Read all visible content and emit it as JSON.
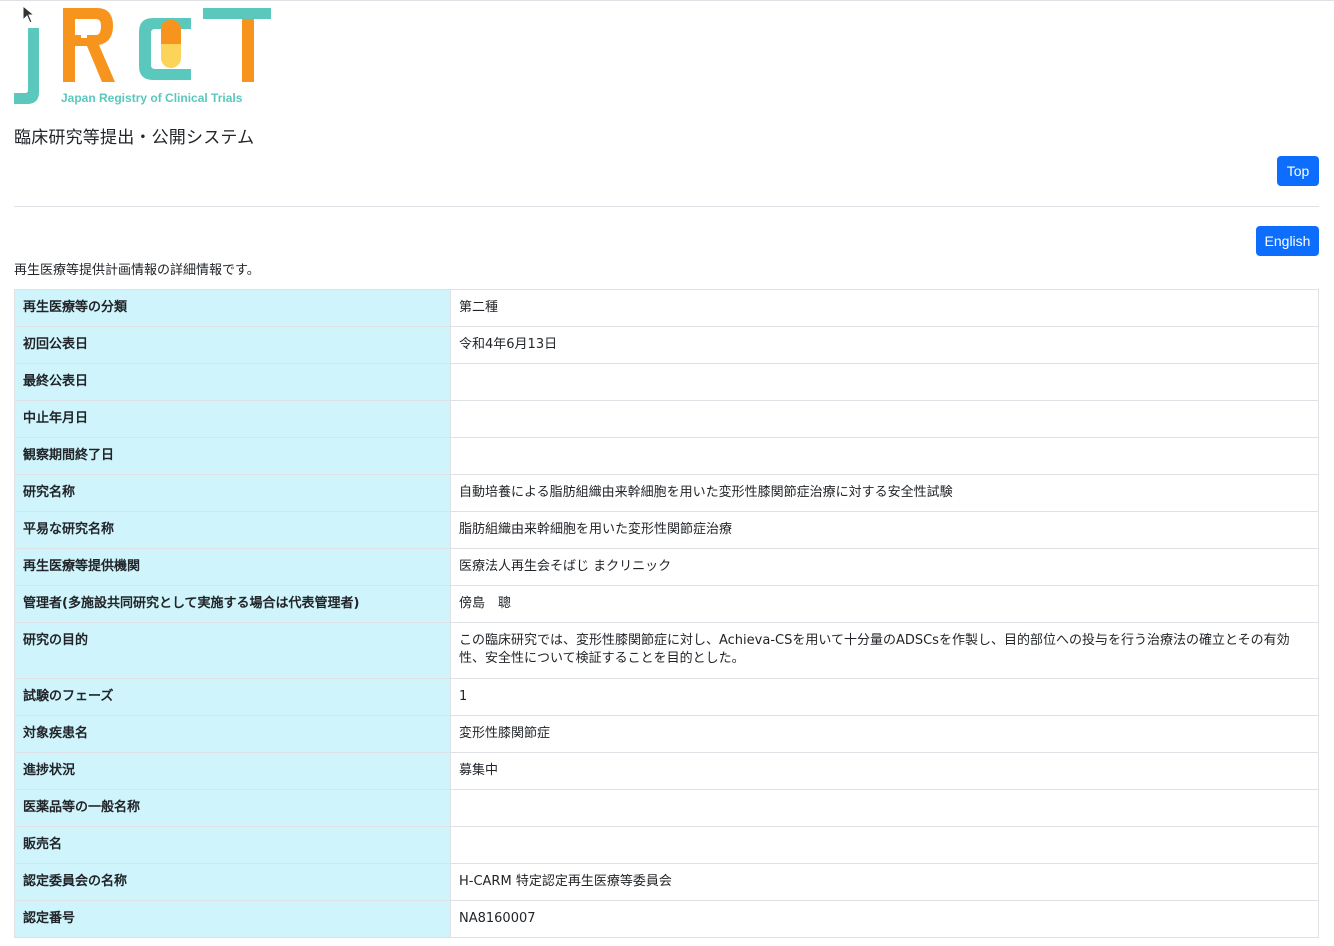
{
  "header": {
    "logo_text": "jRCT",
    "logo_subtitle": "Japan Registry of Clinical Trials",
    "system_title": "臨床研究等提出・公開システム",
    "top_button": "Top"
  },
  "language_button": "English",
  "intro_text": "再生医療等提供計画情報の詳細情報です。",
  "rows": [
    {
      "label": "再生医療等の分類",
      "value": "第二種"
    },
    {
      "label": "初回公表日",
      "value": "令和4年6月13日"
    },
    {
      "label": "最終公表日",
      "value": ""
    },
    {
      "label": "中止年月日",
      "value": ""
    },
    {
      "label": "観察期間終了日",
      "value": ""
    },
    {
      "label": "研究名称",
      "value": "自動培養による脂肪組織由来幹細胞を用いた変形性膝関節症治療に対する安全性試験"
    },
    {
      "label": "平易な研究名称",
      "value": "脂肪組織由来幹細胞を用いた変形性関節症治療"
    },
    {
      "label": "再生医療等提供機関",
      "value": "医療法人再生会そばじ まクリニック"
    },
    {
      "label": "管理者(多施設共同研究として実施する場合は代表管理者)",
      "value": "傍島　聰"
    },
    {
      "label": "研究の目的",
      "value": "この臨床研究では、変形性膝関節症に対し、Achieva-CSを用いて十分量のADSCsを作製し、目的部位への投与を行う治療法の確立とその有効性、安全性について検証することを目的とした。"
    },
    {
      "label": "試験のフェーズ",
      "value": "1"
    },
    {
      "label": "対象疾患名",
      "value": "変形性膝関節症"
    },
    {
      "label": "進捗状況",
      "value": "募集中"
    },
    {
      "label": "医薬品等の一般名称",
      "value": ""
    },
    {
      "label": "販売名",
      "value": ""
    },
    {
      "label": "認定委員会の名称",
      "value": "H-CARM 特定認定再生医療等委員会"
    },
    {
      "label": "認定番号",
      "value": "NA8160007"
    }
  ],
  "colors": {
    "brand_teal": "#5bc8be",
    "brand_orange": "#f7941d",
    "brand_yellow": "#fcd45a",
    "button_blue": "#0d6efd",
    "label_cell_bg": "#cff4fc"
  }
}
